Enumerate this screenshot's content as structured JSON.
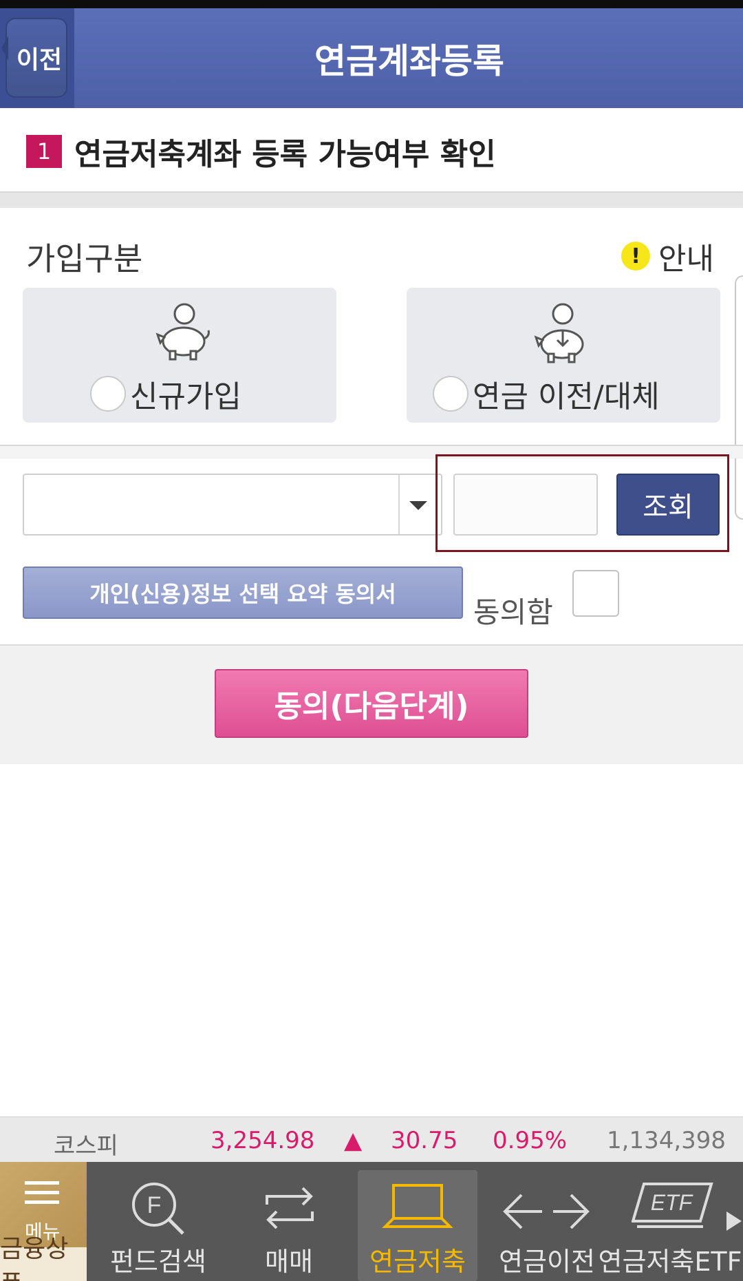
{
  "header": {
    "back_label": "이전",
    "title": "연금계좌등록"
  },
  "section1": {
    "step_number": "1",
    "title": "연금저축계좌 등록 가능여부 확인"
  },
  "join": {
    "label": "가입구분",
    "guide_icon_text": "!",
    "guide_label": "안내",
    "options": [
      {
        "label": "신규가입",
        "icon": "piggy-bank-person-icon",
        "selected": false
      },
      {
        "label": "연금 이전/대체",
        "icon": "piggy-bank-transfer-icon",
        "selected": false
      }
    ]
  },
  "account": {
    "select_value": "",
    "password_value": "",
    "lookup_label": "조회"
  },
  "consent": {
    "button_label": "개인(신용)정보 선택 요약 동의서",
    "agree_label": "동의함",
    "agreed": false
  },
  "next_button_label": "동의(다음단계)",
  "ticker": {
    "name": "코스피",
    "index": "3,254.98",
    "direction": "▲",
    "change": "30.75",
    "rate": "0.95%",
    "volume": "1,134,398"
  },
  "nav": {
    "menu_label": "메뉴",
    "items": [
      {
        "label": "금융상품",
        "icon": "menu-icon"
      },
      {
        "label": "펀드검색",
        "icon": "fund-search-icon"
      },
      {
        "label": "매매",
        "icon": "trade-icon"
      },
      {
        "label": "연금저축",
        "icon": "laptop-icon",
        "active": true
      },
      {
        "label": "연금이전",
        "icon": "transfer-arrows-icon"
      },
      {
        "label": "연금저축ETF",
        "icon": "etf-icon"
      }
    ]
  },
  "colors": {
    "header": "#4d60a8",
    "accent_pink": "#de4f93",
    "ticker_up": "#d81b6a",
    "active_tab_text": "#f5b800"
  }
}
